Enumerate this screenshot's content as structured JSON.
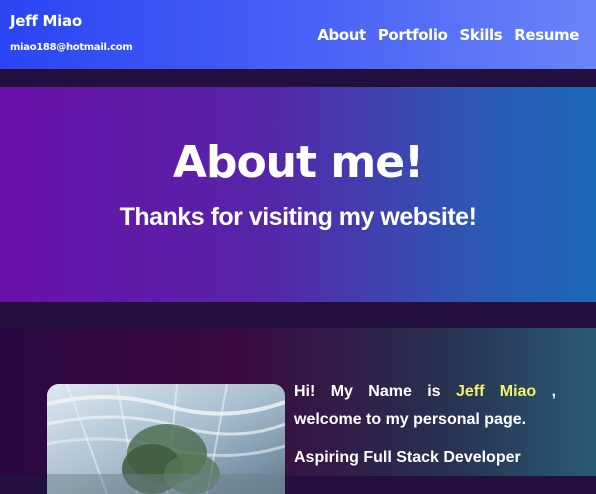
{
  "brand": {
    "name": "Jeff Miao",
    "email": "miao188@hotmail.com"
  },
  "nav": {
    "items": [
      {
        "label": "About"
      },
      {
        "label": "Portfolio"
      },
      {
        "label": "Skills"
      },
      {
        "label": "Resume"
      }
    ]
  },
  "hero": {
    "title": "About me!",
    "subtitle": "Thanks for visiting my website!"
  },
  "about": {
    "greeting_prefix": "Hi! My Name is ",
    "name_highlight": "Jeff Miao",
    "greeting_suffix": " , welcome to my personal page.",
    "paragraph2": "Aspiring Full Stack Developer"
  },
  "colors": {
    "accent": "#f5f16a",
    "nav_start": "#2a45f2",
    "nav_end": "#6a84f8"
  }
}
